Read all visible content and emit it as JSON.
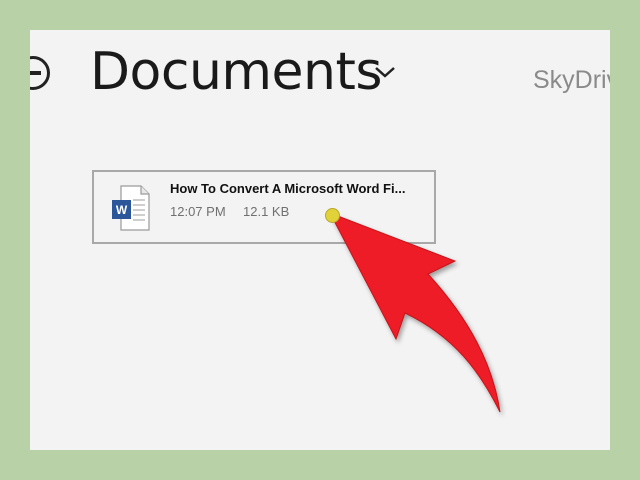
{
  "header": {
    "title": "Documents",
    "location": "SkyDriv"
  },
  "file": {
    "name": "How To Convert A Microsoft Word Fi...",
    "modified_time": "12:07 PM",
    "size": "12.1 KB",
    "icon": "word-document-icon"
  },
  "colors": {
    "frame": "#b8d1a6",
    "background": "#f3f3f3",
    "annotation_arrow": "#ee1c25",
    "word_blue": "#2b579a"
  }
}
